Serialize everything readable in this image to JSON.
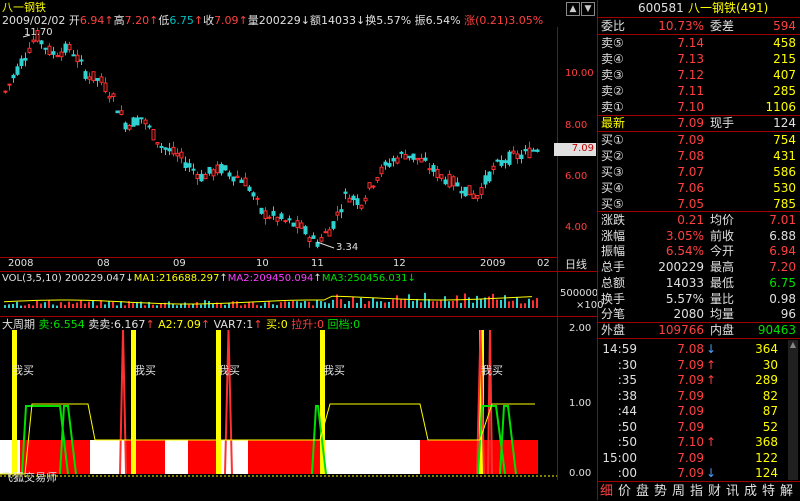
{
  "stock": {
    "name": "八一钢铁",
    "code": "600581",
    "title": "八一钢铁(491)"
  },
  "header": {
    "date": "2009/02/02",
    "open_label": "开",
    "open": "6.94",
    "high_label": "高",
    "high": "7.20",
    "low_label": "低",
    "low": "6.75",
    "close_label": "收",
    "close": "7.09",
    "vol_label": "量",
    "vol": "200229",
    "amt_label": "额",
    "amt": "14033",
    "turn_label": "换",
    "turn": "5.57%",
    "amp_label": "振",
    "amp": "6.54%",
    "chg_label": "涨",
    "chg": "(0.21)",
    "chg_pct": "3.05%"
  },
  "main_chart": {
    "y_ticks": [
      "10.00",
      "8.00",
      "6.00",
      "4.00"
    ],
    "x_labels": [
      "2008",
      "08",
      "09",
      "10",
      "11",
      "12",
      "2009",
      "02"
    ],
    "high_marker": "11.70",
    "low_marker": "3.34",
    "price_tag": "7.09",
    "period_label": "日线"
  },
  "vol_panel": {
    "label": "VOL(3,5,10)",
    "vol": "200229.047",
    "ma1": "MA1:216688.297",
    "ma2": "MA2:209450.094",
    "ma3": "MA3:250456.031",
    "y_tick": "500000",
    "unit": "×100"
  },
  "ind_panel": {
    "name": "大周期",
    "sell_label": "卖:",
    "sell": "6.554",
    "sellsell_label": "卖卖:",
    "sellsell": "6.167",
    "a2": "A2:7.09",
    "var7": "VAR7:1",
    "buy": "买:0",
    "lashen": "拉升:0",
    "huidang": "回档:0",
    "y_ticks": [
      "2.00",
      "1.00",
      "0.00"
    ],
    "buy_tag": "我买",
    "watermark": "飞狐交易师"
  },
  "right_panel": {
    "weibi_label": "委比",
    "weibi": "10.73%",
    "weicha_label": "委差",
    "weicha": "594",
    "sells": [
      {
        "label": "卖⑤",
        "price": "7.14",
        "vol": "458"
      },
      {
        "label": "卖④",
        "price": "7.13",
        "vol": "215"
      },
      {
        "label": "卖③",
        "price": "7.12",
        "vol": "407"
      },
      {
        "label": "卖②",
        "price": "7.11",
        "vol": "285"
      },
      {
        "label": "卖①",
        "price": "7.10",
        "vol": "1106"
      }
    ],
    "last_label": "最新",
    "last": "7.09",
    "now_label": "现手",
    "now": "124",
    "buys": [
      {
        "label": "买①",
        "price": "7.09",
        "vol": "754"
      },
      {
        "label": "买②",
        "price": "7.08",
        "vol": "431"
      },
      {
        "label": "买③",
        "price": "7.07",
        "vol": "586"
      },
      {
        "label": "买④",
        "price": "7.06",
        "vol": "530"
      },
      {
        "label": "买⑤",
        "price": "7.05",
        "vol": "785"
      }
    ],
    "stats": [
      {
        "l1": "涨跌",
        "v1": "0.21",
        "l2": "均价",
        "v2": "7.01",
        "c1": "red",
        "c2": "red"
      },
      {
        "l1": "涨幅",
        "v1": "3.05%",
        "l2": "前收",
        "v2": "6.88",
        "c1": "red",
        "c2": "white"
      },
      {
        "l1": "振幅",
        "v1": "6.54%",
        "l2": "今开",
        "v2": "6.94",
        "c1": "red",
        "c2": "red"
      },
      {
        "l1": "总手",
        "v1": "200229",
        "l2": "最高",
        "v2": "7.20",
        "c1": "white",
        "c2": "red"
      },
      {
        "l1": "总额",
        "v1": "14033",
        "l2": "最低",
        "v2": "6.75",
        "c1": "white",
        "c2": "green"
      },
      {
        "l1": "换手",
        "v1": "5.57%",
        "l2": "量比",
        "v2": "0.98",
        "c1": "white",
        "c2": "white"
      },
      {
        "l1": "分笔",
        "v1": "2080",
        "l2": "均量",
        "v2": "96",
        "c1": "white",
        "c2": "white"
      }
    ],
    "outer_label": "外盘",
    "outer": "109766",
    "inner_label": "内盘",
    "inner": "90463",
    "ticks": [
      {
        "time": "14:59",
        "price": "7.08",
        "arrow": "↓",
        "vol": "364",
        "color": "blue"
      },
      {
        "time": ":30",
        "price": "7.09",
        "arrow": "↑",
        "vol": "30",
        "color": "red"
      },
      {
        "time": ":35",
        "price": "7.09",
        "arrow": "↑",
        "vol": "289",
        "color": "red"
      },
      {
        "time": ":38",
        "price": "7.09",
        "arrow": "",
        "vol": "82",
        "color": "blue"
      },
      {
        "time": ":44",
        "price": "7.09",
        "arrow": "",
        "vol": "87",
        "color": "blue"
      },
      {
        "time": ":50",
        "price": "7.09",
        "arrow": "",
        "vol": "52",
        "color": "blue"
      },
      {
        "time": ":50",
        "price": "7.10",
        "arrow": "↑",
        "vol": "368",
        "color": "red"
      },
      {
        "time": "15:00",
        "price": "7.09",
        "arrow": "",
        "vol": "122",
        "color": "blue"
      },
      {
        "time": ":00",
        "price": "7.09",
        "arrow": "↓",
        "vol": "124",
        "color": "blue"
      }
    ],
    "func_buttons": [
      "细",
      "价",
      "盘",
      "势",
      "周",
      "指",
      "财",
      "讯",
      "成",
      "特",
      "解"
    ]
  }
}
